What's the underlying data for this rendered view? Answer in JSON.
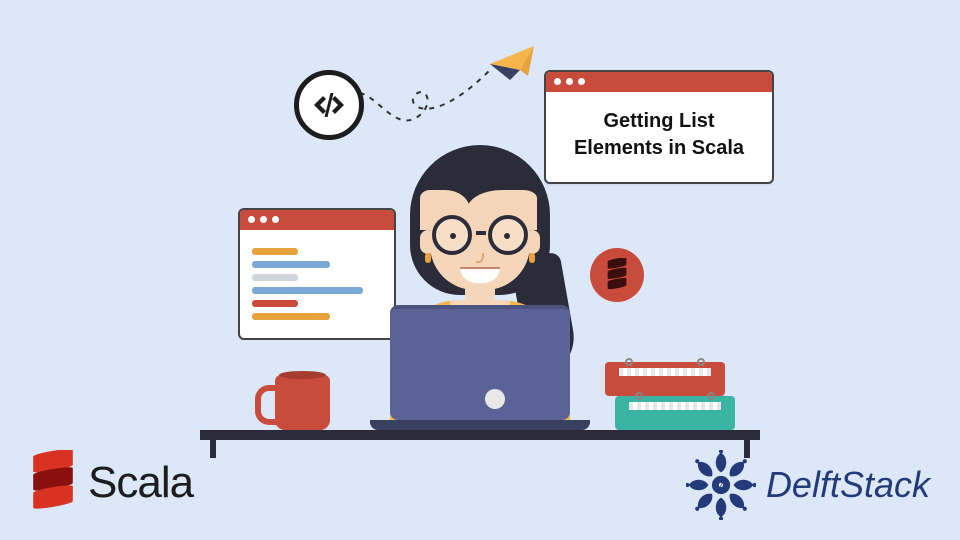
{
  "title_window": {
    "line1": "Getting List",
    "line2": "Elements in Scala"
  },
  "icons": {
    "code_badge": "code-icon",
    "paper_plane": "paper-plane-icon",
    "scala_coin": "scala-logo-coin"
  },
  "logos": {
    "scala_text": "Scala",
    "delftstack_text": "DelftStack"
  },
  "colors": {
    "background": "#dce8f7",
    "accent_red": "#c94b3b",
    "accent_teal": "#3bb5a3",
    "accent_yellow": "#f5b54a",
    "laptop": "#5a6298",
    "delft_blue": "#253a7a"
  }
}
